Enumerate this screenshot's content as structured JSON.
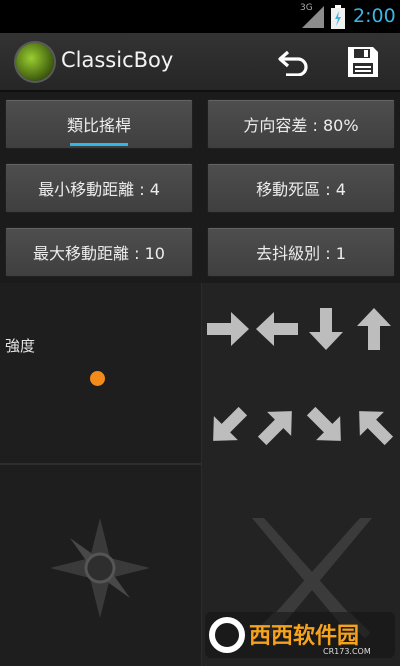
{
  "status": {
    "network": "3G",
    "time": "2:00"
  },
  "app": {
    "title": "ClassicBoy"
  },
  "buttons": {
    "analog": "類比搖桿",
    "tolerance": "方向容差 : 80%",
    "min_move": "最小移動距離 : 4",
    "dead_zone": "移動死區 : 4",
    "max_move": "最大移動距離 : 10",
    "debounce": "去抖級別 : 1"
  },
  "panel": {
    "strength_label": "強度"
  },
  "watermark": {
    "text": "西西软件园",
    "sub": "CR173.COM"
  },
  "icons": {
    "undo": "undo-icon",
    "save": "save-icon",
    "compass": "compass-icon",
    "swords": "crossed-swords-icon",
    "arrows": [
      "arrow-right-icon",
      "arrow-left-icon",
      "arrow-down-icon",
      "arrow-up-icon",
      "arrow-down-left-icon",
      "arrow-up-right-icon",
      "arrow-down-right-icon",
      "arrow-up-left-icon"
    ]
  },
  "colors": {
    "accent": "#33b5e5",
    "time": "#3db3e6",
    "dot": "#f38b1b"
  }
}
